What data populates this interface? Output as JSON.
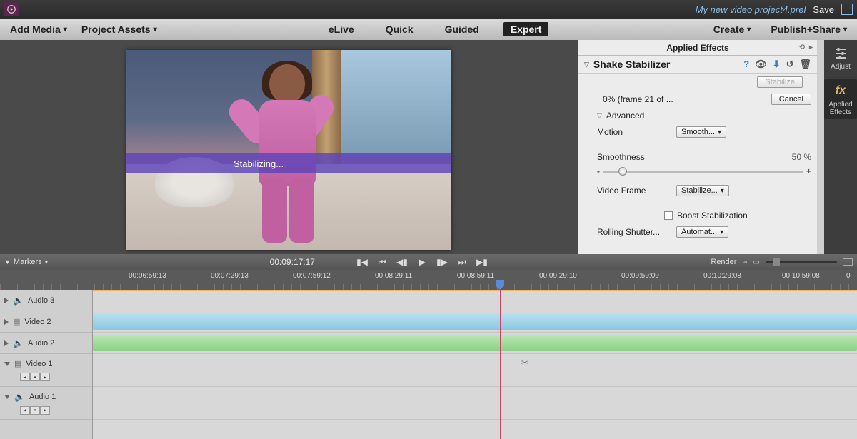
{
  "titlebar": {
    "project_name": "My new video project4.prel",
    "save": "Save"
  },
  "menubar": {
    "add_media": "Add Media",
    "project_assets": "Project Assets",
    "tabs": {
      "elive": "eLive",
      "quick": "Quick",
      "guided": "Guided",
      "expert": "Expert"
    },
    "create": "Create",
    "publish_share": "Publish+Share"
  },
  "preview": {
    "stabilizing": "Stabilizing..."
  },
  "effects": {
    "applied_effects": "Applied Effects",
    "shake_stabilizer": "Shake Stabilizer",
    "stabilize_btn": "Stabilize",
    "progress": "0% (frame 21 of ...",
    "cancel": "Cancel",
    "advanced": "Advanced",
    "motion": "Motion",
    "motion_value": "Smooth...",
    "smoothness": "Smoothness",
    "smoothness_value": "50 %",
    "video_frame": "Video Frame",
    "video_frame_value": "Stabilize...",
    "boost": "Boost Stabilization",
    "rolling_shutter": "Rolling Shutter...",
    "rolling_value": "Automat..."
  },
  "sidebar": {
    "adjust": "Adjust",
    "applied_effects": "Applied Effects"
  },
  "transport": {
    "markers": "Markers",
    "current_tc": "00:09:17:17",
    "render": "Render"
  },
  "ruler": {
    "tcs": [
      "00:06:59:13",
      "00:07:29:13",
      "00:07:59:12",
      "00:08:29:11",
      "00:08:59:11",
      "00:09:29:10",
      "00:09:59:09",
      "00:10:29:08",
      "00:10:59:08",
      "0"
    ]
  },
  "tracks": {
    "audio3": "Audio 3",
    "video2": "Video 2",
    "audio2": "Audio 2",
    "video1": "Video 1",
    "audio1": "Audio 1"
  }
}
